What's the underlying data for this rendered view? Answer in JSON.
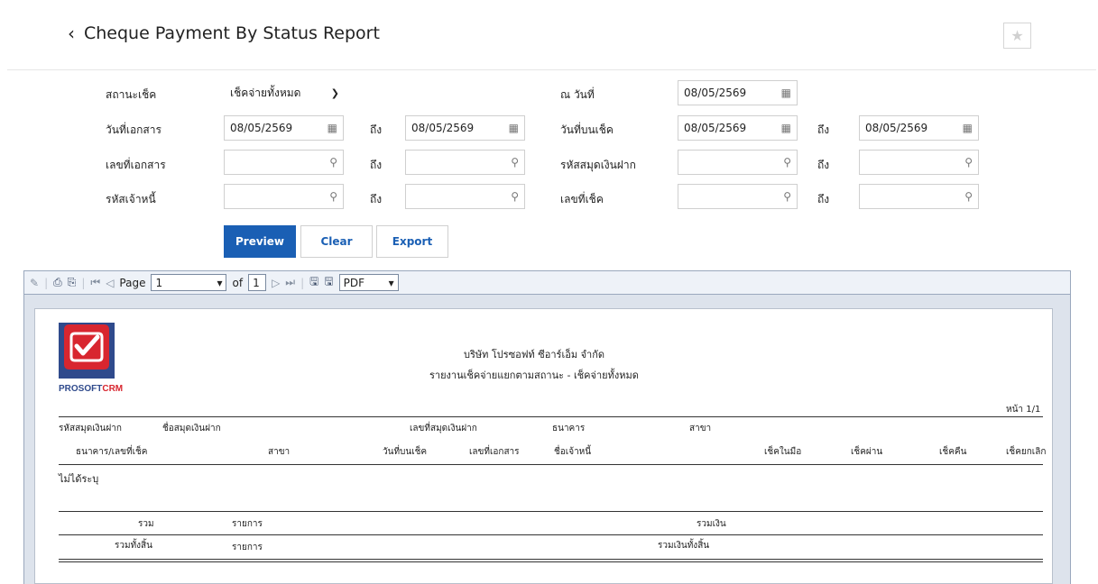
{
  "header": {
    "title": "Cheque Payment By Status Report"
  },
  "filters": {
    "cheque_status": {
      "label": "สถานะเช็ค",
      "value": "เช็คจ่ายทั้งหมด"
    },
    "as_of_date": {
      "label": "ณ วันที่",
      "value": "08/05/2569"
    },
    "doc_date": {
      "label": "วันที่เอกสาร",
      "from": "08/05/2569",
      "to_label": "ถึง",
      "to": "08/05/2569"
    },
    "cheque_date": {
      "label": "วันที่บนเช็ค",
      "from": "08/05/2569",
      "to_label": "ถึง",
      "to": "08/05/2569"
    },
    "doc_no": {
      "label": "เลขที่เอกสาร",
      "from": "",
      "to_label": "ถึง",
      "to": ""
    },
    "bank_book": {
      "label": "รหัสสมุดเงินฝาก",
      "from": "",
      "to_label": "ถึง",
      "to": ""
    },
    "creditor": {
      "label": "รหัสเจ้าหนี้",
      "from": "",
      "to_label": "ถึง",
      "to": ""
    },
    "cheque_no": {
      "label": "เลขที่เช็ค",
      "from": "",
      "to_label": "ถึง",
      "to": ""
    }
  },
  "buttons": {
    "preview": "Preview",
    "clear": "Clear",
    "export": "Export"
  },
  "toolbar": {
    "page_label": "Page",
    "page": "1",
    "of_label": "of",
    "total": "1",
    "format": "PDF"
  },
  "report": {
    "logo_text_a": "PROSOFT",
    "logo_text_b": "CRM",
    "company": "บริษัท โปรซอฟท์ ซีอาร์เอ็ม จำกัด",
    "title": "รายงานเช็คจ่ายแยกตามสถานะ - เช็คจ่ายทั้งหมด",
    "page_no": "หน้า 1/1",
    "head1": [
      "รหัสสมุดเงินฝาก",
      "ชื่อสมุดเงินฝาก",
      "เลขที่สมุดเงินฝาก",
      "ธนาคาร",
      "สาขา"
    ],
    "head2": [
      "ธนาคาร/เลขที่เช็ค",
      "สาขา",
      "วันที่บนเช็ค",
      "เลขที่เอกสาร",
      "ชื่อเจ้าหนี้",
      "เช็คในมือ",
      "เช็คผ่าน",
      "เช็คคืน",
      "เช็คยกเลิก"
    ],
    "group": "ไม่ได้ระบุ",
    "sum_label": "รวม",
    "sum_items": "รายการ",
    "sum_amount": "รวมเงิน",
    "grand_label": "รวมทั้งสิ้น",
    "grand_items": "รายการ",
    "grand_amount": "รวมเงินทั้งสิ้น"
  },
  "colors": {
    "primary": "#1a5fb4",
    "logo_red": "#d8262f"
  }
}
